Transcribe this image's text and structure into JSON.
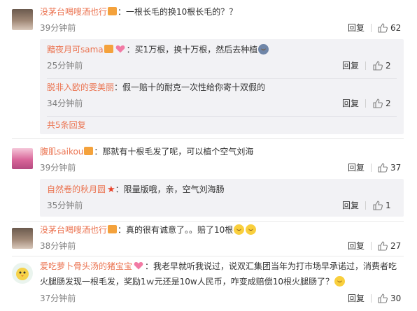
{
  "comments": [
    {
      "user": "没茅台喝嗖酒也行",
      "text": "：一根长毛的换10根长毛的？？",
      "time": "39分钟前",
      "reply_label": "回复",
      "likes": "62",
      "replies": [
        {
          "user": "黯夜月可sama",
          "text": "：买1万根，换十万根，然后去种植",
          "time": "25分钟前",
          "reply_label": "回复",
          "likes": "2"
        },
        {
          "user": "脱非入欧的雯美丽",
          "text": "：假一赔十的耐克一次性给你寄十双假的",
          "time": "34分钟前",
          "reply_label": "回复",
          "likes": "2"
        }
      ],
      "more_label": "共5条回复"
    },
    {
      "user": "腹肌saikou",
      "text": "：那就有十根毛发了呢，可以植个空气刘海",
      "time": "39分钟前",
      "reply_label": "回复",
      "likes": "37",
      "replies": [
        {
          "user": "自然卷的秋月圆",
          "text": "：限量版哦，亲，空气刘海肠",
          "time": "35分钟前",
          "reply_label": "回复",
          "likes": "1"
        }
      ]
    },
    {
      "user": "没茅台喝嗖酒也行",
      "text": "：真的很有诚意了。。赔了10根",
      "time": "38分钟前",
      "reply_label": "回复",
      "likes": "27"
    },
    {
      "user": "爱吃萝卜骨头汤的猪宝宝",
      "text": "：我老早就听我说过，说双汇集团当年为打市场早承诺过，消费者吃",
      "text2": "火腿肠发现一根毛发，奖励1ｗ元还是10w人民币，咋变成赔偿10根火腿肠了？",
      "time": "37分钟前",
      "reply_label": "回复",
      "likes": "30"
    }
  ],
  "colors": {
    "username": "#eb7350",
    "reply_bg": "#f2f2f5",
    "time": "#808080"
  }
}
